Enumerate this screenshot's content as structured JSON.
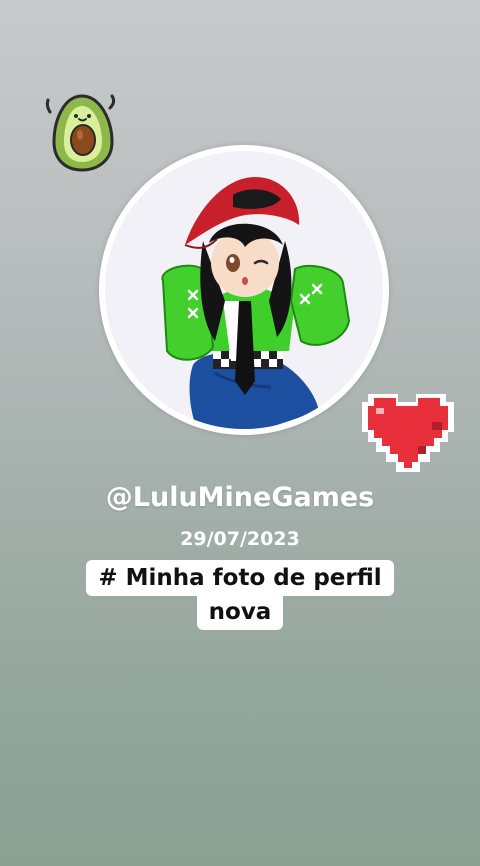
{
  "story": {
    "username": "@LuluMineGames",
    "date": "29/07/2023",
    "caption_line1": "# Minha foto de perfil",
    "caption_line2": "nova"
  },
  "stickers": {
    "top_left": "avocado-icon",
    "right": "pixel-heart-icon"
  },
  "profile_picture": {
    "description_icon": "avatar-icon"
  },
  "colors": {
    "background_top": "#c8cacb",
    "background_bottom": "#8aa194",
    "heart": "#e8303c",
    "cap": "#c8202a",
    "jacket": "#3ecf2a"
  }
}
